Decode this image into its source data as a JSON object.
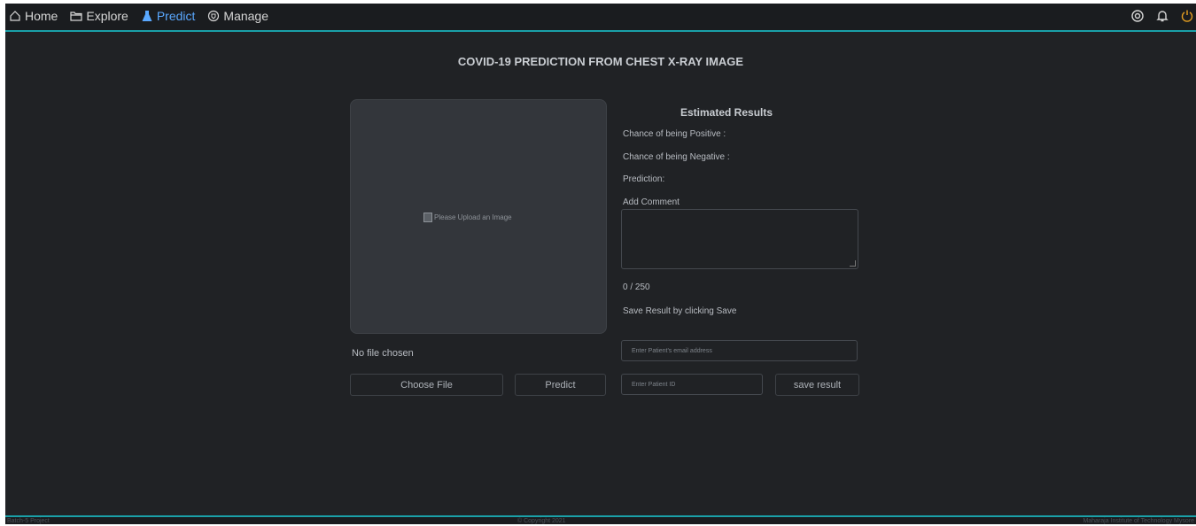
{
  "nav": {
    "items": [
      {
        "label": "Home",
        "icon": "home-icon"
      },
      {
        "label": "Explore",
        "icon": "folder-icon"
      },
      {
        "label": "Predict",
        "icon": "flask-icon",
        "active": true
      },
      {
        "label": "Manage",
        "icon": "shield-icon"
      }
    ],
    "right_icons": [
      "settings-icon",
      "bell-icon",
      "power-icon"
    ]
  },
  "page_title": "COVID-19 PREDICTION FROM CHEST X-RAY IMAGE",
  "upload": {
    "placeholder": "Please Upload an Image",
    "no_file": "No file chosen",
    "choose_file": "Choose File",
    "predict": "Predict"
  },
  "results": {
    "title": "Estimated Results",
    "positive": "Chance of being Positive :",
    "negative": "Chance of being Negative :",
    "prediction": "Prediction:",
    "add_comment": "Add Comment",
    "counter": "0 / 250",
    "save_hint": "Save Result by clicking Save",
    "email_placeholder": "Enter Patient's email address",
    "id_placeholder": "Enter Patient ID",
    "save_button": "save result"
  },
  "footer": {
    "left": "Batch-5 Project",
    "center": "© Copyright 2021",
    "right": "Maharaja Institute of Technology Mysore"
  },
  "colors": {
    "accent": "#1aa0a8",
    "active": "#5aa8ff",
    "background": "#202225"
  }
}
